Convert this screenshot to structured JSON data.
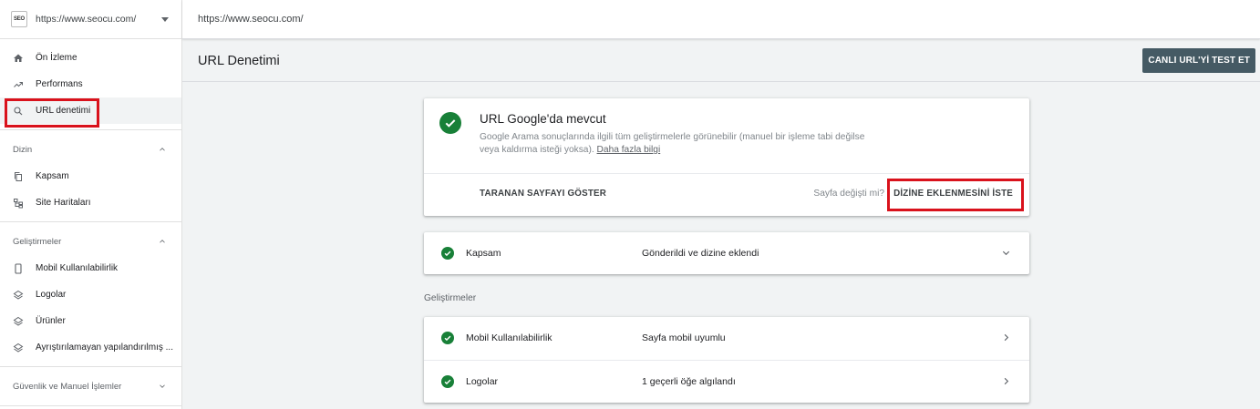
{
  "property": {
    "logo_text": "SEO",
    "url": "https://www.seocu.com/"
  },
  "topbar": {
    "url": "https://www.seocu.com/"
  },
  "sidebar": {
    "main_items": [
      {
        "label": "Ön İzleme",
        "icon": "home-icon"
      },
      {
        "label": "Performans",
        "icon": "trending-up-icon"
      },
      {
        "label": "URL denetimi",
        "icon": "search-icon"
      }
    ],
    "sections": [
      {
        "title": "Dizin",
        "items": [
          {
            "label": "Kapsam",
            "icon": "copy-icon"
          },
          {
            "label": "Site Haritaları",
            "icon": "sitemap-icon"
          }
        ]
      },
      {
        "title": "Geliştirmeler",
        "items": [
          {
            "label": "Mobil Kullanılabilirlik",
            "icon": "phone-icon"
          },
          {
            "label": "Logolar",
            "icon": "layers-icon"
          },
          {
            "label": "Ürünler",
            "icon": "layers-icon"
          },
          {
            "label": "Ayrıştırılamayan yapılandırılmış ...",
            "icon": "layers-icon"
          }
        ]
      },
      {
        "title": "Güvenlik ve Manuel İşlemler",
        "items": []
      }
    ]
  },
  "header": {
    "title": "URL Denetimi",
    "live_test_label": "CANLI URL'Yİ TEST ET"
  },
  "status_card": {
    "title": "URL Google'da mevcut",
    "desc": "Google Arama sonuçlarında ilgili tüm geliştirmelerle görünebilir (manuel bir işleme tabi değilse veya kaldırma isteği yoksa).",
    "learn_more": "Daha fazla bilgi",
    "crawled_label": "TARANAN SAYFAYI GÖSTER",
    "changed_question": "Sayfa değişti mi?",
    "request_index_label": "DİZİNE EKLENMESİNİ İSTE"
  },
  "coverage": {
    "label": "Kapsam",
    "value": "Gönderildi ve dizine eklendi"
  },
  "enhancements": {
    "label": "Geliştirmeler",
    "rows": [
      {
        "label": "Mobil Kullanılabilirlik",
        "value": "Sayfa mobil uyumlu"
      },
      {
        "label": "Logolar",
        "value": "1 geçerli öğe algılandı"
      }
    ]
  },
  "colors": {
    "accent_dark": "#455a64",
    "success_green": "#188038",
    "highlight_red": "#d9121c"
  }
}
